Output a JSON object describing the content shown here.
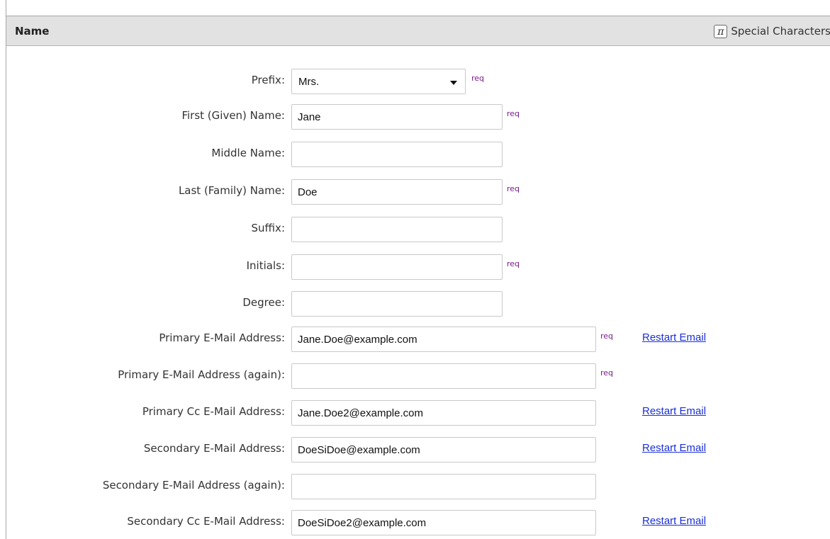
{
  "section": {
    "title": "Name",
    "special_characters_label": "Special Characters",
    "special_characters_icon": "π"
  },
  "req_label": "req",
  "restart_label": "Restart Email",
  "colors": {
    "header_bg": "#e2e2e2",
    "req": "#7a1e8c",
    "link": "#1a2fd6"
  },
  "fields": {
    "prefix": {
      "label": "Prefix:",
      "value": "Mrs."
    },
    "first_name": {
      "label": "First (Given) Name:",
      "value": "Jane"
    },
    "middle_name": {
      "label": "Middle Name:",
      "value": ""
    },
    "last_name": {
      "label": "Last (Family) Name:",
      "value": "Doe"
    },
    "suffix": {
      "label": "Suffix:",
      "value": ""
    },
    "initials": {
      "label": "Initials:",
      "value": ""
    },
    "degree": {
      "label": "Degree:",
      "value": ""
    },
    "primary_email": {
      "label": "Primary E-Mail Address:",
      "value": "Jane.Doe@example.com"
    },
    "primary_email_again": {
      "label": "Primary E-Mail Address (again):",
      "value": ""
    },
    "primary_cc_email": {
      "label": "Primary Cc E-Mail Address:",
      "value": "Jane.Doe2@example.com"
    },
    "secondary_email": {
      "label": "Secondary E-Mail Address:",
      "value": "DoeSiDoe@example.com"
    },
    "secondary_email_again": {
      "label": "Secondary E-Mail Address (again):",
      "value": ""
    },
    "secondary_cc_email": {
      "label": "Secondary Cc E-Mail Address:",
      "value": "DoeSiDoe2@example.com"
    }
  }
}
